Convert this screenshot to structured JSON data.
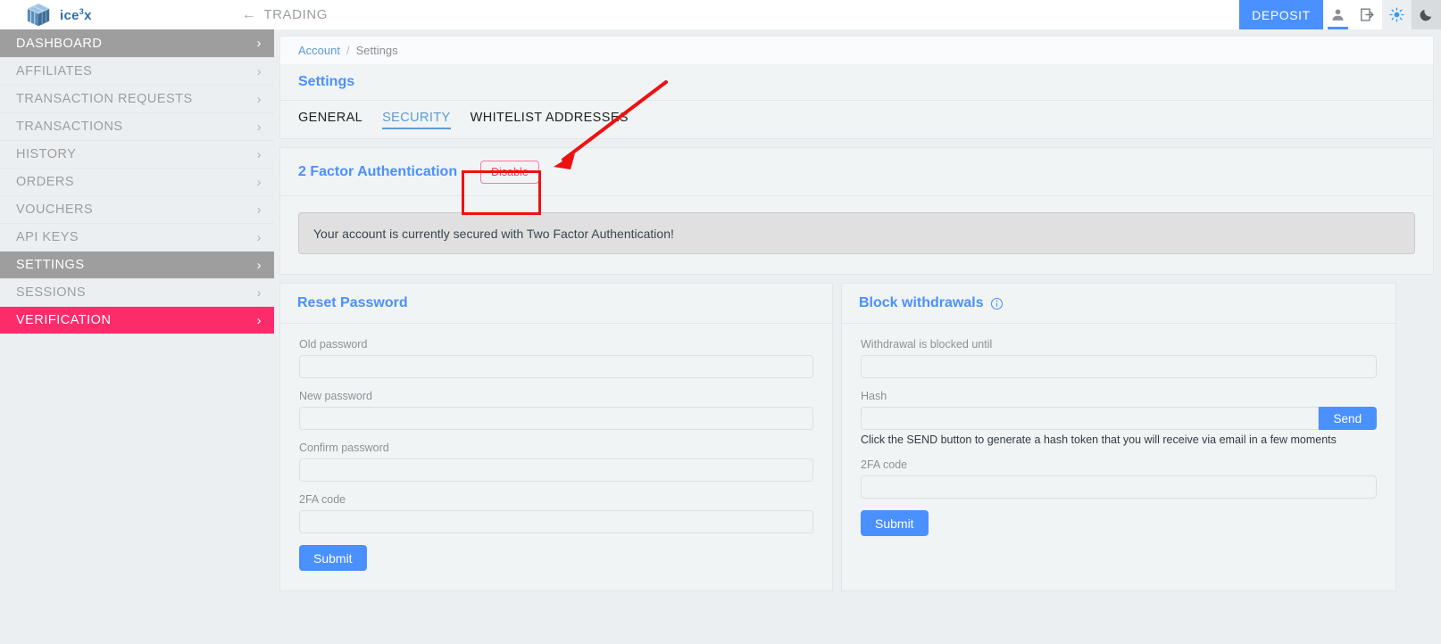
{
  "topbar": {
    "brand_name": "ice",
    "brand_sup": "3",
    "brand_suffix": "x",
    "trading_label": "TRADING",
    "back_arrow": "←",
    "deposit_label": "DEPOSIT",
    "icons": {
      "account": "person-icon",
      "logout": "logout-icon",
      "light_theme": "sun-icon",
      "dark_theme": "moon-icon"
    }
  },
  "sidebar": {
    "items": [
      {
        "label": "DASHBOARD",
        "state": "selected"
      },
      {
        "label": "AFFILIATES",
        "state": "default"
      },
      {
        "label": "TRANSACTION REQUESTS",
        "state": "default"
      },
      {
        "label": "TRANSACTIONS",
        "state": "default"
      },
      {
        "label": "HISTORY",
        "state": "default"
      },
      {
        "label": "ORDERS",
        "state": "default"
      },
      {
        "label": "VOUCHERS",
        "state": "default"
      },
      {
        "label": "API KEYS",
        "state": "default"
      },
      {
        "label": "SETTINGS",
        "state": "selected"
      },
      {
        "label": "SESSIONS",
        "state": "default"
      },
      {
        "label": "VERIFICATION",
        "state": "alert"
      }
    ],
    "chevron": "›"
  },
  "breadcrumb": {
    "parent": "Account",
    "separator": "/",
    "current": "Settings"
  },
  "settings": {
    "title": "Settings",
    "tabs": [
      {
        "label": "GENERAL",
        "active": false
      },
      {
        "label": "SECURITY",
        "active": true
      },
      {
        "label": "WHITELIST ADDRESSES",
        "active": false
      }
    ]
  },
  "two_factor": {
    "title": "2 Factor Authentication",
    "disable_label": "Disable",
    "notice": "Your account is currently secured with Two Factor Authentication!"
  },
  "reset_password": {
    "title": "Reset Password",
    "fields": [
      {
        "label": "Old password",
        "value": "",
        "placeholder": ""
      },
      {
        "label": "New password",
        "value": "",
        "placeholder": ""
      },
      {
        "label": "Confirm password",
        "value": "",
        "placeholder": ""
      },
      {
        "label": "2FA code",
        "value": "",
        "placeholder": ""
      }
    ],
    "submit_label": "Submit"
  },
  "block_withdrawals": {
    "title": "Block withdrawals",
    "info_icon": "info-circle-icon",
    "blocked_until_label": "Withdrawal is blocked until",
    "blocked_until_value": "",
    "hash_label": "Hash",
    "hash_value": "",
    "send_label": "Send",
    "help_text": "Click the SEND button to generate a hash token that you will receive via email in a few moments",
    "twofa_label": "2FA code",
    "twofa_value": "",
    "submit_label": "Submit"
  },
  "annotations": {
    "highlight_box_target": "Disable",
    "arrow_color": "#ee1111",
    "box_color": "#ee1111"
  },
  "colors": {
    "accent_blue": "#4a90ff",
    "link_blue": "#5b9bd5",
    "alert_pink": "#fc2c6b",
    "selected_gray": "#9e9e9e",
    "page_bg": "#eceff1"
  }
}
